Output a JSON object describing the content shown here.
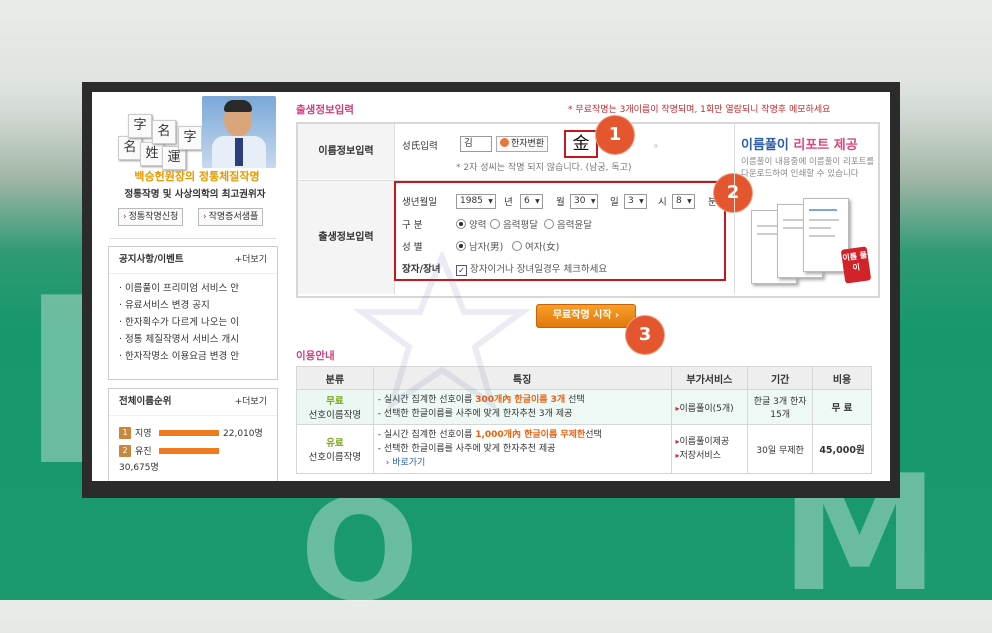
{
  "background": {
    "letters": [
      "L",
      "O",
      "M"
    ]
  },
  "promo": {
    "cube_chars": [
      "名",
      "姓",
      "運",
      "字",
      "名",
      "字"
    ],
    "title": "백승헌원장의 정통체질작명",
    "subtitle": "정통작명 및 사상의학의 최고권위자",
    "btn_apply": "정통작명신청",
    "btn_sample": "작명증서샘플"
  },
  "notices": {
    "title": "공지사항/이벤트",
    "more": "+더보기",
    "items": [
      "이름풀이 프리미엄 서비스 안",
      "유료서비스 변경 공지",
      "한자획수가 다르게 나오는 이",
      "정통 체질작명서 서비스 개시",
      "한자작명소 이용요금 변경 안"
    ]
  },
  "ranking": {
    "title": "전체이름순위",
    "more": "+더보기",
    "rows": [
      {
        "rank": "1",
        "name": "지영",
        "count": "22,010명",
        "fraction": 1.0
      },
      {
        "rank": "2",
        "name": "유진",
        "count": "30,675명",
        "fraction": 1.0
      }
    ]
  },
  "form": {
    "section_title": "출생정보입력",
    "notice": "* 무료작명는 3개이름이 작명되며, 1회만 열람되니 작명후 메모하세요",
    "name_label": "이름정보입력",
    "surname_label": "성氏입력",
    "surname_value": "김",
    "hanja_btn": "한자변환",
    "hanja_char": "金",
    "dot": "。",
    "surname_note": "* 2자 성씨는 작명 되지 않습니다. (남궁, 독고)",
    "birth_label": "출생정보입력",
    "birth_date_label": "생년월일",
    "year": "1985",
    "year_unit": "년",
    "month": "6",
    "month_unit": "월",
    "day": "30",
    "day_unit": "일",
    "hour": "3",
    "hour_unit": "시",
    "minute": "8",
    "minute_unit": "분",
    "calendar_label": "구 분",
    "calendar_options": [
      "양력",
      "음력평달",
      "음력윤달"
    ],
    "gender_label": "성 별",
    "gender_options": [
      "남자(男)",
      "여자(女)"
    ],
    "eldest_label": "장자/장녀",
    "eldest_check": "장자이거나 장녀일경우 체크하세요",
    "markers": [
      "1",
      "2",
      "3"
    ]
  },
  "report": {
    "title_blue": "이름풀이",
    "title_pink": "리포트 제공",
    "desc": "이름풀이 내용중에 이름풀이 리포트를 다운로드하여 인쇄할 수 있습니다",
    "sticker": "이름 풀이"
  },
  "start_button": "무료작명 시작",
  "guide": {
    "section_title": "이용안내",
    "headers": [
      "분류",
      "특징",
      "부가서비스",
      "기간",
      "비용"
    ],
    "rows": [
      {
        "type_top": "무료",
        "type_bottom": "선호이름작명",
        "feature1_a": "- 실시간 집계한 선호이름 ",
        "feature1_hl": "300개內 한글이름 3개",
        "feature1_b": " 선택",
        "feature2": "- 선택한 한글이름를 사주에 맞게 한자추천 3개 제공",
        "extra": "이름풀이(5개)",
        "period": "한글 3개 한자 15개",
        "cost": "무 료"
      },
      {
        "type_top": "유료",
        "type_bottom": "선호이름작명",
        "feature1_a": "- 실시간 집계한 선호이름 ",
        "feature1_hl": "1,000개內 한글이름 무제한",
        "feature1_b": "선택",
        "feature2": "- 선택한 한글이름를 사주에 맞게 한자추천 제공",
        "link": "바로가기",
        "extra1": "이름풀이제공",
        "extra2": "저장서비스",
        "period": "30일 무제한",
        "cost": "45,000원"
      }
    ]
  }
}
